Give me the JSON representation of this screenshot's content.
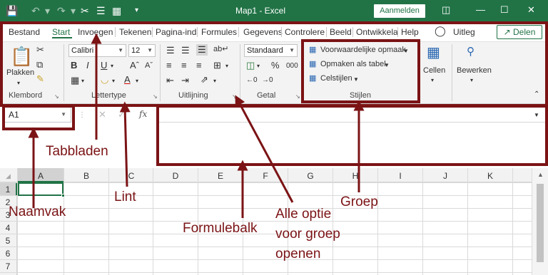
{
  "titlebar": {
    "title": "Map1  -  Excel",
    "signin_label": "Aanmelden",
    "icons": [
      "save-icon",
      "undo-icon",
      "redo-icon",
      "clear-format-icon",
      "form-icon",
      "camera-icon",
      "customize-toolbar-icon",
      "ribbon-display-icon",
      "minimize-icon",
      "maximize-icon",
      "close-icon"
    ]
  },
  "ribbon": {
    "tabs": [
      "Bestand",
      "Start",
      "Invoegen",
      "Tekenen",
      "Pagina-ind",
      "Formules",
      "Gegevens",
      "Controlere",
      "Beeld",
      "Ontwikkela",
      "Help"
    ],
    "active_tab": "Start",
    "tellme_label": "Uitleg",
    "share_label": "Delen",
    "clipboard": {
      "paste_label": "Plakken",
      "group_label": "Klembord"
    },
    "font": {
      "font_name": "Calibri",
      "font_size": "12",
      "group_label": "Lettertype"
    },
    "alignment": {
      "group_label": "Uitlijning"
    },
    "number": {
      "format": "Standaard",
      "group_label": "Getal"
    },
    "styles": {
      "conditional_label": "Voorwaardelijke opmaak",
      "table_label": "Opmaken als tabel",
      "cellstyles_label": "Celstijlen",
      "group_label": "Stijlen"
    },
    "cells": {
      "label": "Cellen"
    },
    "editing": {
      "label": "Bewerken"
    }
  },
  "formula_bar": {
    "namebox_value": "A1",
    "fx_label": "fx",
    "formula_value": ""
  },
  "grid": {
    "columns": [
      "A",
      "B",
      "C",
      "D",
      "E",
      "F",
      "G",
      "H",
      "I",
      "J",
      "K"
    ],
    "rows": [
      "1",
      "2",
      "3",
      "4",
      "5",
      "6",
      "7"
    ],
    "selected_cell": "A1"
  },
  "annotations": {
    "tabbladen": "Tabbladen",
    "naamvak": "Naamvak",
    "lint": "Lint",
    "formulebalk": "Formulebalk",
    "alle_opties_1": "Alle optie",
    "alle_opties_2": "voor groep",
    "alle_opties_3": "openen",
    "groep": "Groep"
  },
  "colors": {
    "excel_green": "#217346",
    "annotation_red": "#7b1315"
  }
}
